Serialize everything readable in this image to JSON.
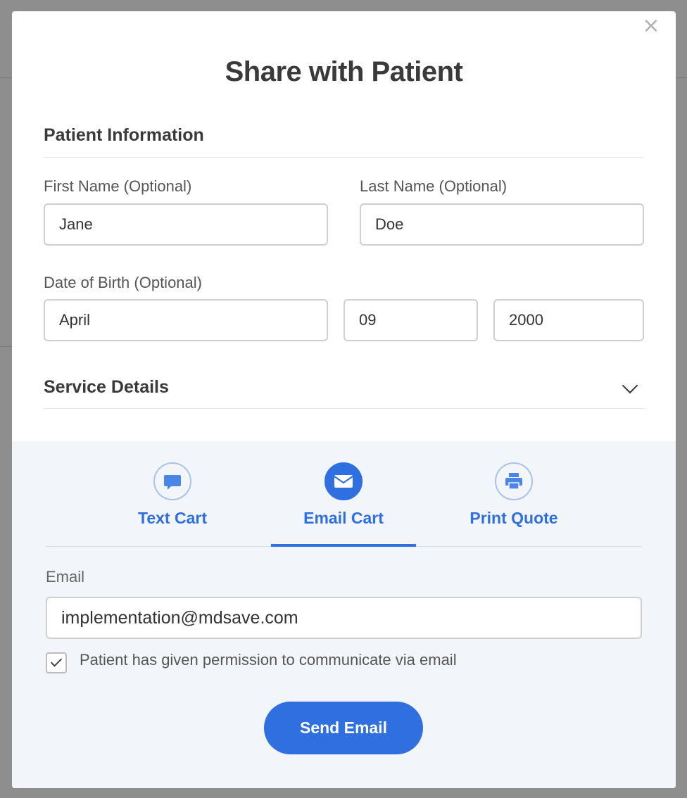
{
  "modal": {
    "title": "Share with Patient",
    "close_glyph": "×"
  },
  "patient_info": {
    "heading": "Patient Information",
    "first_name": {
      "label": "First Name (Optional)",
      "value": "Jane"
    },
    "last_name": {
      "label": "Last Name (Optional)",
      "value": "Doe"
    },
    "dob": {
      "label": "Date of Birth (Optional)",
      "month": "April",
      "day": "09",
      "year": "2000"
    }
  },
  "service_details": {
    "heading": "Service Details",
    "expanded": false
  },
  "share": {
    "tabs": [
      {
        "label": "Text Cart",
        "icon": "chat-bubble-icon",
        "active": false
      },
      {
        "label": "Email Cart",
        "icon": "envelope-icon",
        "active": true
      },
      {
        "label": "Print Quote",
        "icon": "printer-icon",
        "active": false
      }
    ],
    "email_label": "Email",
    "email_value": "implementation@mdsave.com",
    "permission_text": "Patient has given permission to communicate via email",
    "permission_checked": true,
    "send_label": "Send Email"
  },
  "colors": {
    "accent": "#2f6fe0",
    "share_bg": "#f2f6fa",
    "overlay": "#8e8e8e"
  }
}
